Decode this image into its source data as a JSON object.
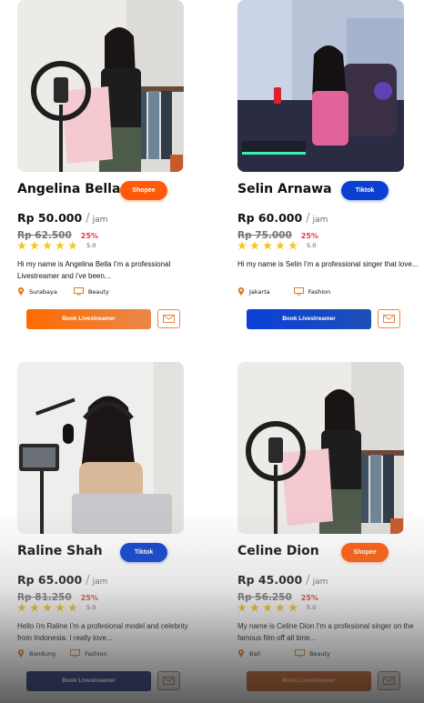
{
  "cards": [
    {
      "name": "Angelina Bella",
      "platform": "Shopee",
      "price": "Rp 50.000",
      "per": "jam",
      "old_price": "Rp 62.500",
      "discount": "25%",
      "rating": "5.0",
      "stars": 5,
      "description": "Hi  my name is Angelina Bella I'm a professional Livestreamer and i've been...",
      "location": "Surabaya",
      "category": "Beauty",
      "book_label": "Book Livestreamer"
    },
    {
      "name": "Selin Arnawa",
      "platform": "Tiktok",
      "price": "Rp 60.000",
      "per": "jam",
      "old_price": "Rp 75.000",
      "discount": "25%",
      "rating": "5.0",
      "stars": 5,
      "description": "Hi  my name is Selin I'm a professional singer that love...",
      "location": "Jakarta",
      "category": "Fashion",
      "book_label": "Book Livestreamer"
    },
    {
      "name": "Raline Shah",
      "platform": "Tiktok",
      "price": "Rp 65.000",
      "per": "jam",
      "old_price": "Rp 81.250",
      "discount": "25%",
      "rating": "5.0",
      "stars": 5,
      "description": "Hello i'm Raline I'm a profesional model and celebrity from Indonesia. I really love...",
      "location": "Bandung",
      "category": "Fashion",
      "book_label": "Book Livestreamer"
    },
    {
      "name": "Celine Dion",
      "platform": "Shopee",
      "price": "Rp 45.000",
      "per": "jam",
      "old_price": "Rp 56.250",
      "discount": "25%",
      "rating": "5.0",
      "stars": 5,
      "description": "My name is Celine Dion I'm a profesional singer on the famous film off all time...",
      "location": "Bali",
      "category": "Beauty",
      "book_label": "Book Livestreamer"
    }
  ],
  "icons": {
    "star": "star-icon",
    "location": "location-pin-icon",
    "category": "monitor-icon",
    "mail": "mail-icon"
  },
  "colors": {
    "shopee": "#ff5a0a",
    "tiktok": "#0a3fcf",
    "star": "#f5c518",
    "discount": "#e53935",
    "meta_icon": "#e07a1f"
  }
}
